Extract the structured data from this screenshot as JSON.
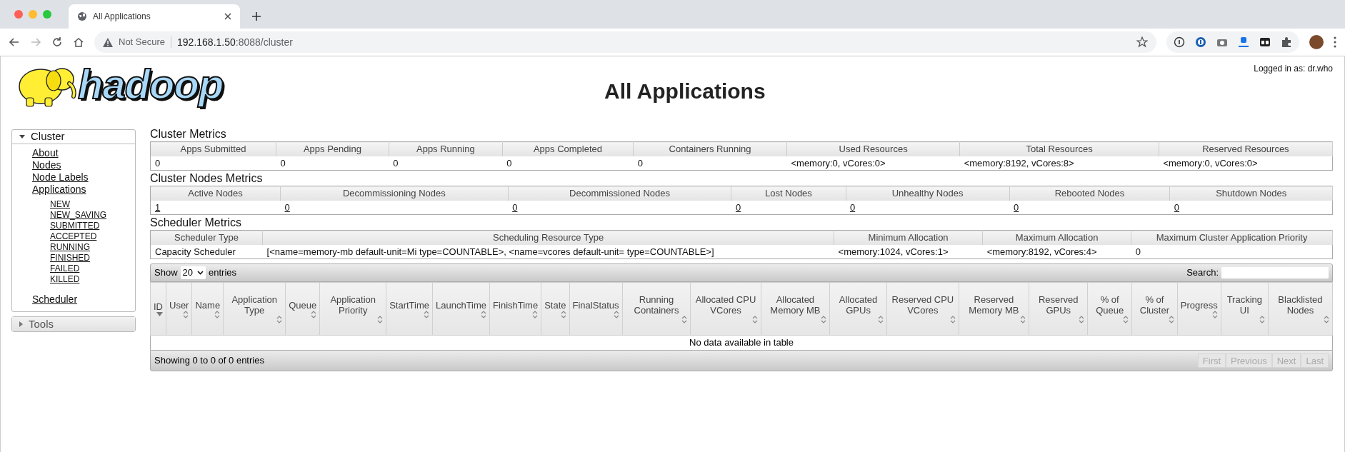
{
  "browser": {
    "tab_title": "All Applications",
    "security": "Not Secure",
    "url_host": "192.168.1.50",
    "url_rest": ":8088/cluster"
  },
  "header": {
    "logged_in": "Logged in as: dr.who",
    "logo_text": "hadoop",
    "title": "All Applications"
  },
  "sidebar": [
    {
      "label": "Cluster",
      "expanded": true,
      "items": [
        {
          "label": "About"
        },
        {
          "label": "Nodes"
        },
        {
          "label": "Node Labels"
        },
        {
          "label": "Applications",
          "children": [
            {
              "label": "NEW"
            },
            {
              "label": "NEW_SAVING"
            },
            {
              "label": "SUBMITTED"
            },
            {
              "label": "ACCEPTED"
            },
            {
              "label": "RUNNING"
            },
            {
              "label": "FINISHED"
            },
            {
              "label": "FAILED"
            },
            {
              "label": "KILLED"
            }
          ]
        },
        {
          "label": "Scheduler"
        }
      ]
    },
    {
      "label": "Tools",
      "expanded": false
    }
  ],
  "metrics": [
    {
      "title": "Cluster Metrics",
      "columns": [
        "Apps Submitted",
        "Apps Pending",
        "Apps Running",
        "Apps Completed",
        "Containers Running",
        "Used Resources",
        "Total Resources",
        "Reserved Resources"
      ],
      "values": [
        {
          "text": "0",
          "link": false
        },
        {
          "text": "0",
          "link": false
        },
        {
          "text": "0",
          "link": false
        },
        {
          "text": "0",
          "link": false
        },
        {
          "text": "0",
          "link": false
        },
        {
          "text": "<memory:0, vCores:0>",
          "link": false
        },
        {
          "text": "<memory:8192, vCores:8>",
          "link": false
        },
        {
          "text": "<memory:0, vCores:0>",
          "link": false
        }
      ]
    },
    {
      "title": "Cluster Nodes Metrics",
      "columns": [
        "Active Nodes",
        "Decommissioning Nodes",
        "Decommissioned Nodes",
        "Lost Nodes",
        "Unhealthy Nodes",
        "Rebooted Nodes",
        "Shutdown Nodes"
      ],
      "values": [
        {
          "text": "1",
          "link": true
        },
        {
          "text": "0",
          "link": true
        },
        {
          "text": "0",
          "link": true
        },
        {
          "text": "0",
          "link": true
        },
        {
          "text": "0",
          "link": true
        },
        {
          "text": "0",
          "link": true
        },
        {
          "text": "0",
          "link": true
        }
      ]
    },
    {
      "title": "Scheduler Metrics",
      "columns": [
        "Scheduler Type",
        "Scheduling Resource Type",
        "Minimum Allocation",
        "Maximum Allocation",
        "Maximum Cluster Application Priority"
      ],
      "values": [
        {
          "text": "Capacity Scheduler",
          "link": false
        },
        {
          "text": "[<name=memory-mb default-unit=Mi type=COUNTABLE>, <name=vcores default-unit= type=COUNTABLE>]",
          "link": false
        },
        {
          "text": "<memory:1024, vCores:1>",
          "link": false
        },
        {
          "text": "<memory:8192, vCores:4>",
          "link": false
        },
        {
          "text": "0",
          "link": false
        }
      ]
    }
  ],
  "apps_table": {
    "show_label": "Show",
    "page_size": "20",
    "entries_label": "entries",
    "search_label": "Search:",
    "columns": [
      {
        "label": "ID",
        "sorted": true
      },
      {
        "label": "User",
        "sorted": false
      },
      {
        "label": "Name",
        "sorted": false
      },
      {
        "label": "Application Type",
        "sorted": false
      },
      {
        "label": "Queue",
        "sorted": false
      },
      {
        "label": "Application Priority",
        "sorted": false
      },
      {
        "label": "StartTime",
        "sorted": false
      },
      {
        "label": "LaunchTime",
        "sorted": false
      },
      {
        "label": "FinishTime",
        "sorted": false
      },
      {
        "label": "State",
        "sorted": false
      },
      {
        "label": "FinalStatus",
        "sorted": false
      },
      {
        "label": "Running Containers",
        "sorted": false
      },
      {
        "label": "Allocated CPU VCores",
        "sorted": false
      },
      {
        "label": "Allocated Memory MB",
        "sorted": false
      },
      {
        "label": "Allocated GPUs",
        "sorted": false
      },
      {
        "label": "Reserved CPU VCores",
        "sorted": false
      },
      {
        "label": "Reserved Memory MB",
        "sorted": false
      },
      {
        "label": "Reserved GPUs",
        "sorted": false
      },
      {
        "label": "% of Queue",
        "sorted": false
      },
      {
        "label": "% of Cluster",
        "sorted": false
      },
      {
        "label": "Progress",
        "sorted": false
      },
      {
        "label": "Tracking UI",
        "sorted": false
      },
      {
        "label": "Blacklisted Nodes",
        "sorted": false
      }
    ],
    "empty_message": "No data available in table",
    "info": "Showing 0 to 0 of 0 entries",
    "pagination": [
      {
        "label": "First",
        "disabled": true
      },
      {
        "label": "Previous",
        "disabled": true
      },
      {
        "label": "Next",
        "disabled": true
      },
      {
        "label": "Last",
        "disabled": true
      }
    ]
  }
}
